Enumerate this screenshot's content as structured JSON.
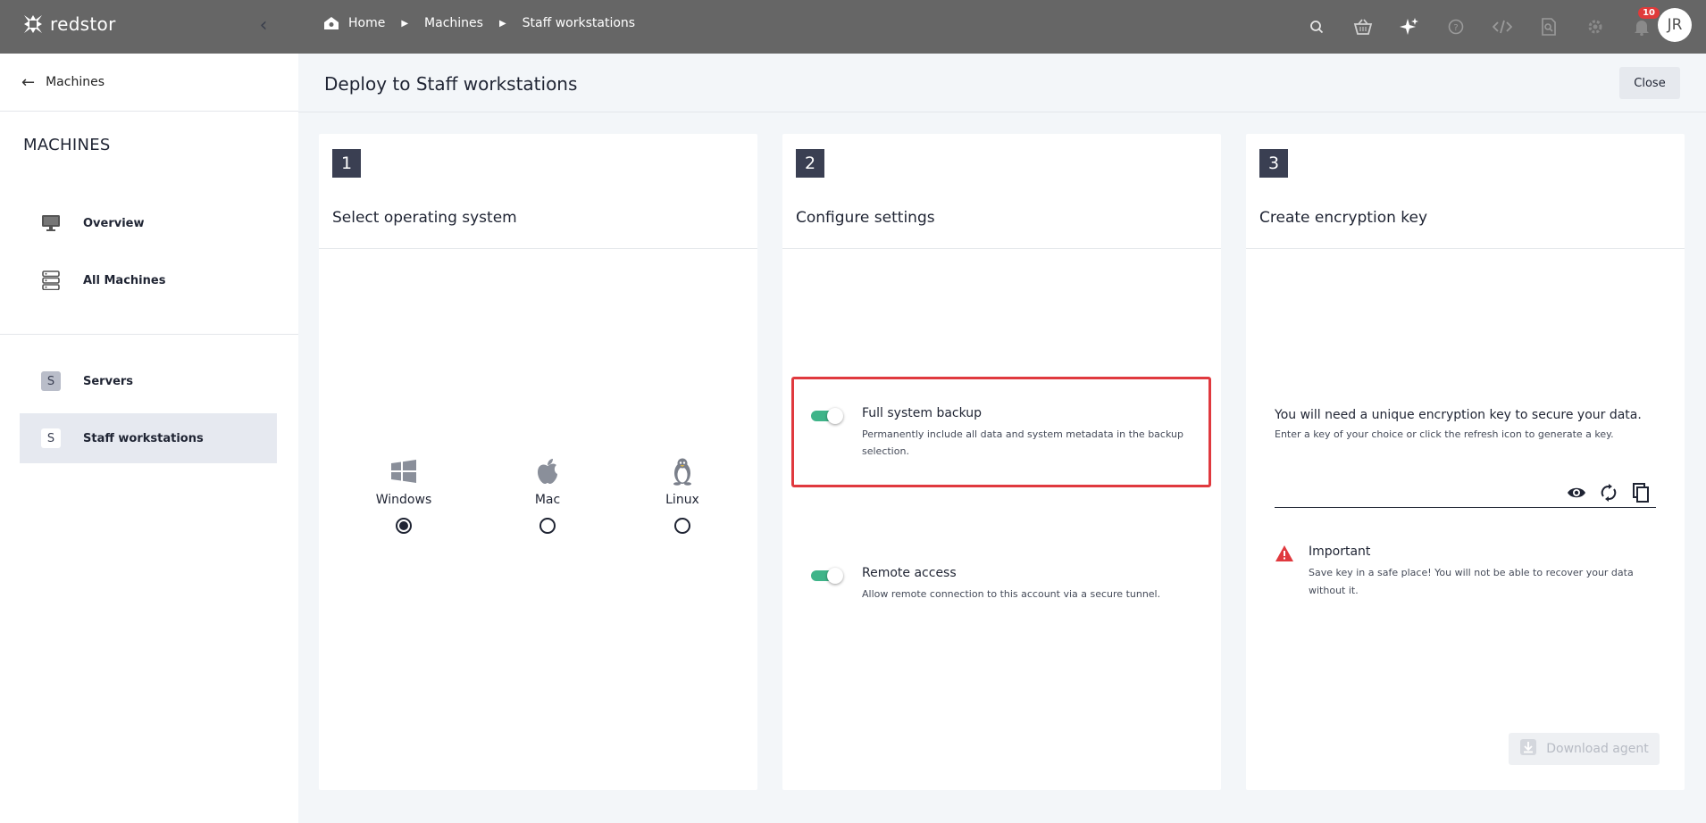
{
  "app": {
    "logo_text": "redstor"
  },
  "breadcrumbs": [
    "Home",
    "Machines",
    "Staff workstations"
  ],
  "topbar": {
    "notification_count": "10",
    "user_initials": "JR"
  },
  "sidebar": {
    "back_label": "Machines",
    "section_title": "MACHINES",
    "nav_items": [
      {
        "label": "Overview",
        "icon": "monitor-icon"
      },
      {
        "label": "All Machines",
        "icon": "server-stack-icon"
      }
    ],
    "groups": [
      {
        "label": "Servers",
        "letter": "S",
        "active": false
      },
      {
        "label": "Staff workstations",
        "letter": "S",
        "active": true
      }
    ]
  },
  "header": {
    "title": "Deploy to Staff workstations",
    "close_label": "Close"
  },
  "steps": [
    {
      "number": "1",
      "title": "Select operating system"
    },
    {
      "number": "2",
      "title": "Configure settings"
    },
    {
      "number": "3",
      "title": "Create encryption key"
    }
  ],
  "os_options": [
    {
      "label": "Windows",
      "selected": true
    },
    {
      "label": "Mac",
      "selected": false
    },
    {
      "label": "Linux",
      "selected": false
    }
  ],
  "settings": [
    {
      "title": "Full system backup",
      "description": "Permanently include all data and system metadata in the backup selection.",
      "enabled": true
    },
    {
      "title": "Remote access",
      "description": "Allow remote connection to this account via a secure tunnel.",
      "enabled": true
    }
  ],
  "encryption": {
    "main_text": "You will need a unique encryption key to secure your data.",
    "sub_text": "Enter a key of your choice or click the refresh icon to generate a key.",
    "key_value": "",
    "warning_title": "Important",
    "warning_text": "Save key in a safe place! You will not be able to recover your data without it.",
    "download_label": "Download agent"
  },
  "colors": {
    "topbar": "#666666",
    "accent_toggle": "#3fb489",
    "highlight": "#e0393e",
    "step_badge": "#3a3f52",
    "warning": "#e0393e"
  }
}
